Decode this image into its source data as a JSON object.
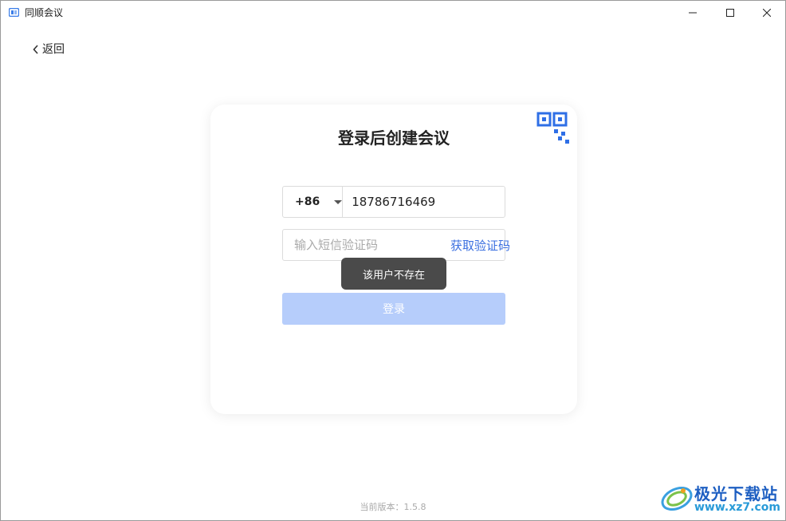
{
  "window": {
    "title": "同顺会议",
    "icon": "app-logo-icon",
    "controls": {
      "minimize": "minimize-icon",
      "maximize": "maximize-icon",
      "close": "close-icon"
    }
  },
  "nav": {
    "back_label": "返回",
    "back_icon": "chevron-left-icon"
  },
  "login_card": {
    "title": "登录后创建会议",
    "qr_icon": "qr-code-icon",
    "country_code": "+86",
    "phone_value": "18786716469",
    "code_placeholder": "输入短信验证码",
    "get_code_label": "获取验证码",
    "toast_message": "该用户不存在",
    "login_label": "登录"
  },
  "footer": {
    "version_text": "当前版本：1.5.8"
  },
  "watermark": {
    "brand": "极光下载站",
    "url": "www.xz7.com"
  },
  "colors": {
    "accent": "#3a6fe0",
    "login_disabled": "#b6cdfb",
    "toast_bg": "#4a4a4a"
  }
}
